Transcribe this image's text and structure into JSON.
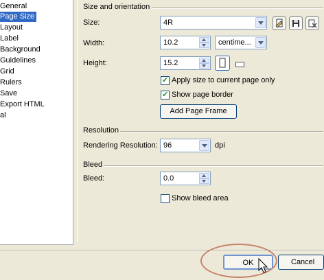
{
  "tree": {
    "items": [
      {
        "label": "General",
        "selected": false
      },
      {
        "label": "Page Size",
        "selected": true
      },
      {
        "label": "Layout",
        "selected": false
      },
      {
        "label": "Label",
        "selected": false
      },
      {
        "label": "Background",
        "selected": false
      },
      {
        "label": "Guidelines",
        "selected": false
      },
      {
        "label": "Grid",
        "selected": false
      },
      {
        "label": "Rulers",
        "selected": false
      },
      {
        "label": "Save",
        "selected": false
      },
      {
        "label": "Export HTML",
        "selected": false
      },
      {
        "label": "al",
        "selected": false
      }
    ]
  },
  "size_orientation": {
    "title": "Size and orientation",
    "size_label": "Size:",
    "size_value": "4R",
    "width_label": "Width:",
    "width_value": "10.2",
    "units_value": "centime...",
    "height_label": "Height:",
    "height_value": "15.2",
    "apply_current_label": "Apply size to current page only",
    "apply_current_checked": true,
    "show_border_label": "Show page border",
    "show_border_checked": true,
    "add_frame_label": "Add Page Frame"
  },
  "resolution": {
    "title": "Resolution",
    "rendering_label": "Rendering Resolution:",
    "rendering_value": "96",
    "unit": "dpi"
  },
  "bleed": {
    "title": "Bleed",
    "bleed_label": "Bleed:",
    "bleed_value": "0.0",
    "show_bleed_label": "Show bleed area",
    "show_bleed_checked": false
  },
  "footer": {
    "ok_label": "OK",
    "cancel_label": "Cancel"
  },
  "colors": {
    "selection": "#316ac5",
    "highlight_ellipse": "#c8826a"
  },
  "icons": [
    "edit-page-size-icon",
    "save-page-size-icon",
    "delete-page-size-icon",
    "portrait-icon",
    "landscape-icon",
    "mouse-cursor-icon"
  ]
}
